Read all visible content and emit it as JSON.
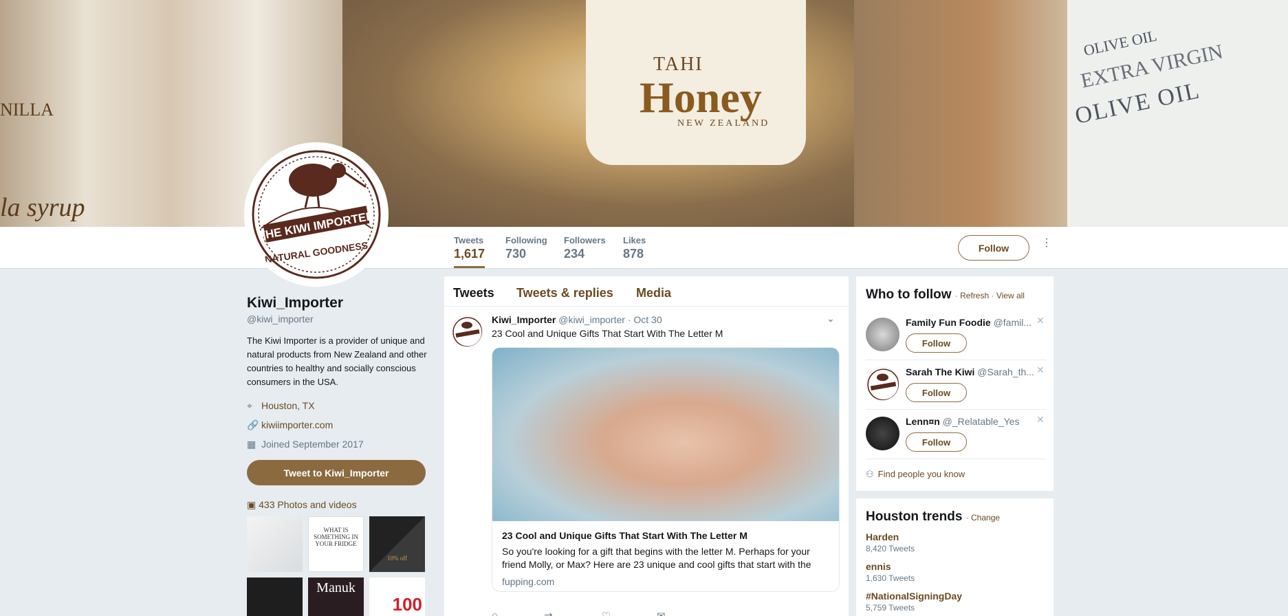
{
  "cover": {
    "jar_line1": "TAHI",
    "jar_line2": "Honey",
    "jar_line3": "NEW ZEALAND",
    "bottle_line1": "OLIVE OIL",
    "bottle_line2": "OLIVE OIL",
    "bottle_line3": "EXTRA VIRGIN",
    "syrup_line1": "la syrup",
    "syrup_line2": "NILLA"
  },
  "avatar": {
    "brand_top": "THE KIWI IMPORTER",
    "brand_bottom": "NATURAL GOODNESS"
  },
  "nav": {
    "stats": [
      {
        "label": "Tweets",
        "value": "1,617"
      },
      {
        "label": "Following",
        "value": "730"
      },
      {
        "label": "Followers",
        "value": "234"
      },
      {
        "label": "Likes",
        "value": "878"
      }
    ],
    "follow_label": "Follow",
    "more_icon": "⋮"
  },
  "profile": {
    "name": "Kiwi_Importer",
    "handle": "@kiwi_importer",
    "bio": "The Kiwi Importer is a provider of unique and natural products from New Zealand and other countries to healthy and socially conscious consumers in the USA.",
    "location": "Houston, TX",
    "website": "kiwiimporter.com",
    "joined": "Joined September 2017",
    "tweet_to_label": "Tweet to Kiwi_Importer",
    "photos_label": "433 Photos and videos",
    "thumb2_text": "WHAT IS SOMETHING IN YOUR FRIDGE",
    "thumb3_text": "10% off",
    "thumb5_text": "Manuk",
    "thumb6_text": "100"
  },
  "timeline": {
    "tabs": [
      "Tweets",
      "Tweets & replies",
      "Media"
    ],
    "tweet": {
      "name": "Kiwi_Importer",
      "handle": "@kiwi_importer",
      "date": "· Oct 30",
      "text": "23 Cool and Unique Gifts That Start With The Letter M",
      "card_title": "23 Cool and Unique Gifts That Start With The Letter M",
      "card_desc": "So you're looking for a gift that begins with the letter M. Perhaps for your friend Molly, or Max? Here are 23 unique and cool gifts that start with the",
      "card_url": "fupping.com"
    }
  },
  "who_to_follow": {
    "title": "Who to follow",
    "refresh": "Refresh",
    "view_all": "View all",
    "users": [
      {
        "name": "Family Fun Foodie",
        "handle": "@famil...",
        "follow": "Follow"
      },
      {
        "name": "Sarah The Kiwi",
        "handle": "@Sarah_th...",
        "follow": "Follow"
      },
      {
        "name": "Lenn¤n",
        "handle": "@_Relatable_Yes",
        "follow": "Follow"
      }
    ],
    "find_people": "Find people you know"
  },
  "trends": {
    "title": "Houston trends",
    "change": "Change",
    "items": [
      {
        "name": "Harden",
        "count": "8,420 Tweets"
      },
      {
        "name": "ennis",
        "count": "1,630 Tweets"
      },
      {
        "name": "#NationalSigningDay",
        "count": "5,759 Tweets"
      }
    ]
  }
}
